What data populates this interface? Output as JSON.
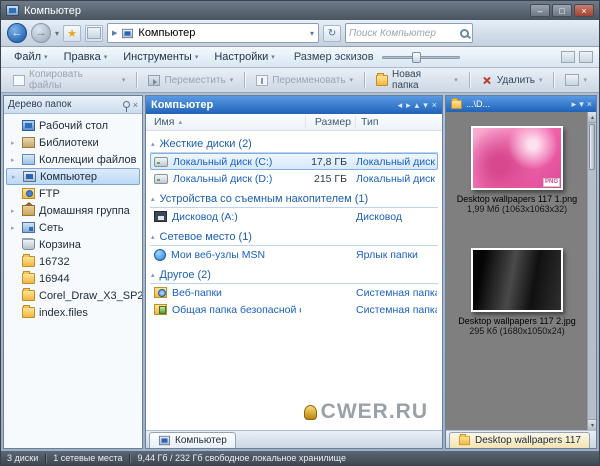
{
  "window": {
    "title": "Компьютер"
  },
  "icons": {
    "back": "←",
    "forward": "→",
    "dropdown": "▾",
    "crumb": "▶",
    "refresh": "↻",
    "star": "★",
    "minimize": "–",
    "maximize": "□",
    "close": "×",
    "sort": "▴",
    "left": "◂",
    "right": "▸",
    "up": "▴",
    "down": "▾"
  },
  "navbar": {
    "address": "Компьютер",
    "search_placeholder": "Поиск Компьютер"
  },
  "menubar": {
    "items": [
      "Файл",
      "Правка",
      "Инструменты",
      "Настройки"
    ],
    "thumb_label": "Размер эскизов"
  },
  "toolbar": {
    "buttons": [
      "Копировать файлы",
      "Переместить",
      "Переименовать",
      "Новая папка",
      "Удалить"
    ]
  },
  "tree": {
    "header": "Дерево папок",
    "items": [
      {
        "label": "Рабочий стол",
        "exp": ""
      },
      {
        "label": "Библиотеки",
        "exp": "▸"
      },
      {
        "label": "Коллекции файлов",
        "exp": "▸"
      },
      {
        "label": "Компьютер",
        "exp": "▸"
      },
      {
        "label": "FTP",
        "exp": ""
      },
      {
        "label": "Домашняя группа",
        "exp": "▸"
      },
      {
        "label": "Сеть",
        "exp": "▸"
      },
      {
        "label": "Корзина",
        "exp": ""
      },
      {
        "label": "16732",
        "exp": ""
      },
      {
        "label": "16944",
        "exp": ""
      },
      {
        "label": "Corel_Draw_X3_SP2",
        "exp": ""
      },
      {
        "label": "index.files",
        "exp": ""
      }
    ]
  },
  "files": {
    "header": "Компьютер",
    "columns": {
      "name": "Имя",
      "size": "Размер",
      "type": "Тип"
    },
    "groups": [
      {
        "label": "Жесткие диски (2)"
      },
      {
        "label": "Устройства со съемным накопителем (1)"
      },
      {
        "label": "Сетевое место (1)"
      },
      {
        "label": "Другое (2)"
      }
    ],
    "rows": {
      "c": {
        "name": "Локальный диск (C:)",
        "size": "17,8 ГБ",
        "type": "Локальный диск"
      },
      "d": {
        "name": "Локальный диск (D:)",
        "size": "215 ГБ",
        "type": "Локальный диск"
      },
      "a": {
        "name": "Дисковод (A:)",
        "size": "",
        "type": "Дисковод"
      },
      "msn": {
        "name": "Мои веб-узлы MSN",
        "size": "",
        "type": "Ярлык папки"
      },
      "web": {
        "name": "Веб-папки",
        "size": "",
        "type": "Системная папка"
      },
      "secure": {
        "name": "Общая папка безопасной среды",
        "size": "",
        "type": "Системная папка"
      }
    },
    "watermark": "CWER.RU",
    "tab": "Компьютер"
  },
  "preview": {
    "header": "...\\D...",
    "items": [
      {
        "caption": "Desktop wallpapers 117 1.png",
        "meta": "1,99 Мб (1063x1063x32)",
        "badge": "PNG"
      },
      {
        "caption": "Desktop wallpapers 117 2.jpg",
        "meta": "295 Кб (1680x1050x24)",
        "badge": ""
      }
    ],
    "tab": "Desktop wallpapers 117"
  },
  "status": {
    "disks": "3 диски",
    "net": "1 сетевые места",
    "storage": "9,44 Гб / 232 Гб свободное локальное хранилище"
  }
}
